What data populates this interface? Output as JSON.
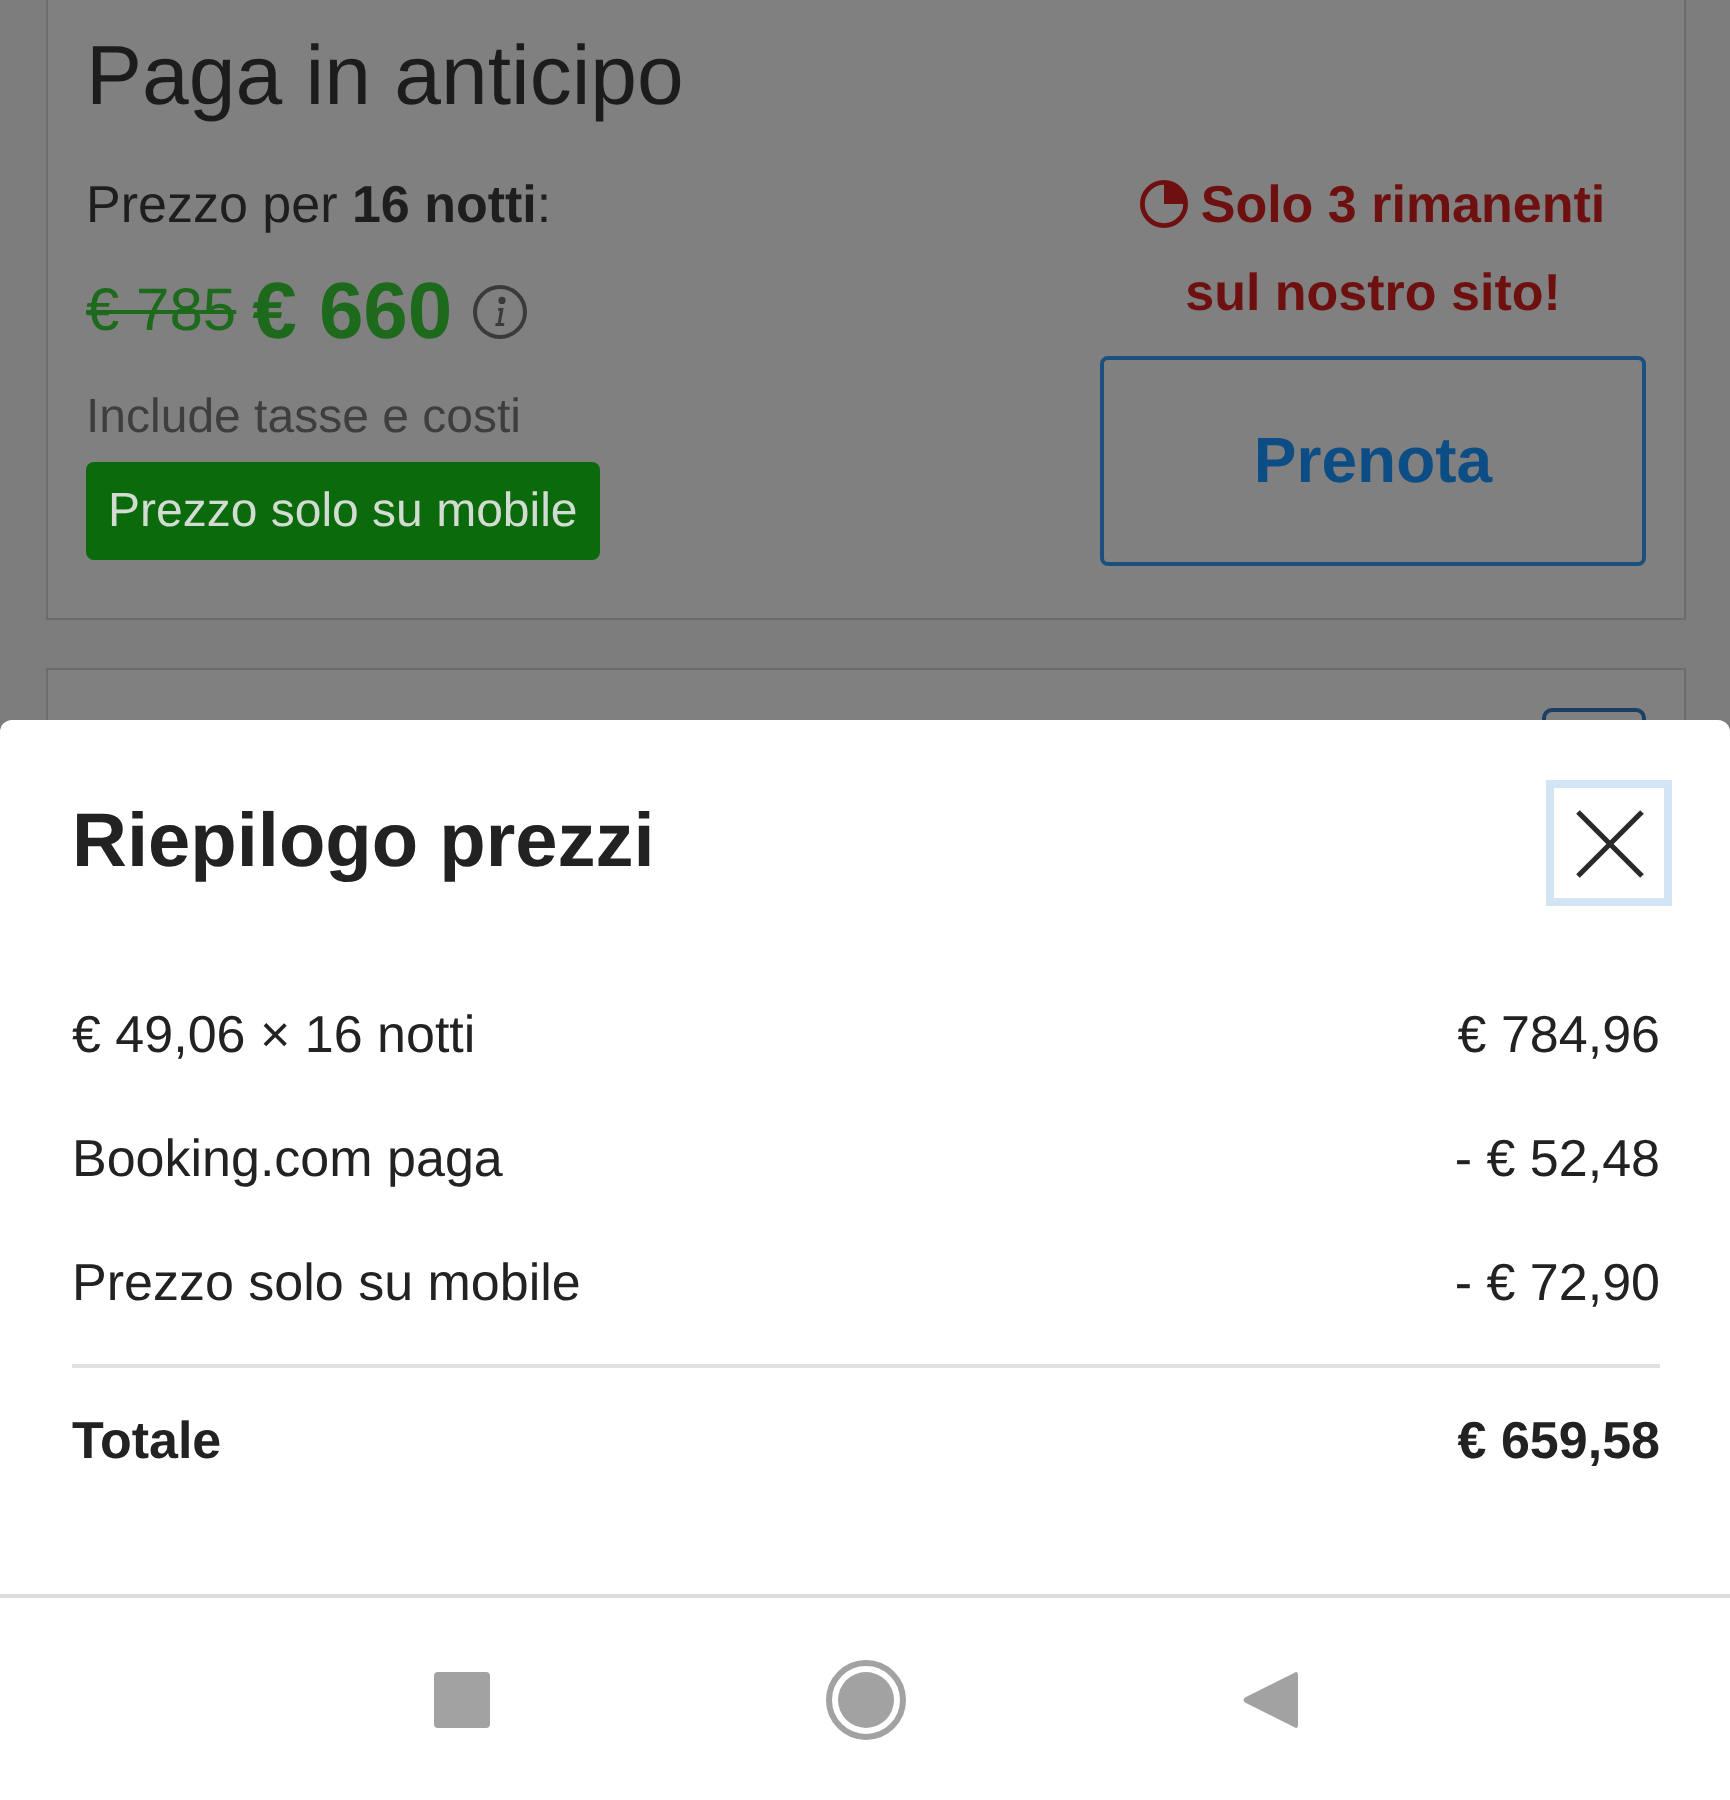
{
  "rate_card": {
    "title": "Paga in anticipo",
    "price_label": "Prezzo per **16 notti**:",
    "original_price": "€ 785",
    "price": "€ 660",
    "taxes_note": "Include tasse e costi",
    "badge": "Prezzo solo su mobile",
    "availability": "Solo 3 rimanenti sul nostro sito!",
    "book_button": "Prenota"
  },
  "price_summary": {
    "title": "Riepilogo prezzi",
    "lines": [
      {
        "label": "€ 49,06 × 16 notti",
        "amount": "€ 784,96"
      },
      {
        "label": "Booking.com paga",
        "amount": "- € 52,48"
      },
      {
        "label": "Prezzo solo su mobile",
        "amount": "- € 72,90"
      }
    ],
    "total": {
      "label": "Totale",
      "amount": "€ 659,58"
    }
  }
}
